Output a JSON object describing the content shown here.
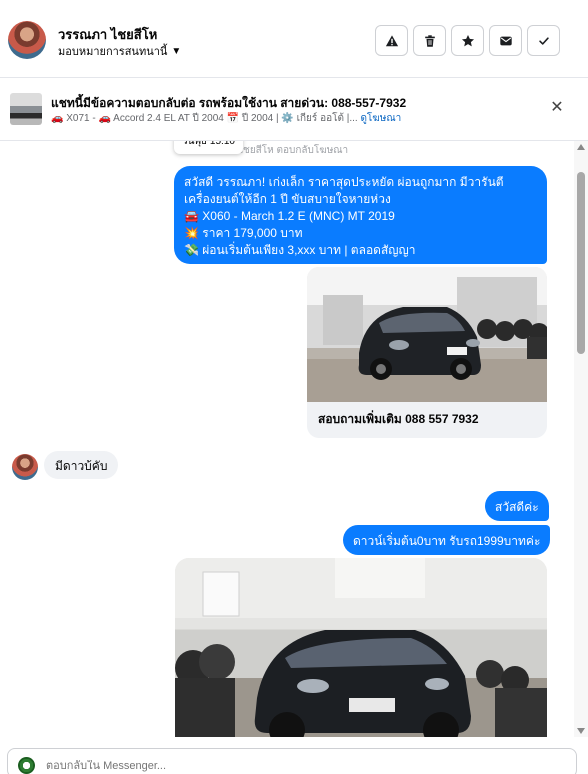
{
  "header": {
    "contact_name": "วรรณภา ไชยสีโห",
    "assign_label": "มอบหมายการสนทนานี้",
    "buttons": [
      "warning-icon",
      "trash-icon",
      "star-icon",
      "envelope-icon",
      "check-icon"
    ]
  },
  "ad": {
    "title": "แชทนี้มีข้อความตอบกลับต่อ รถพร้อมใช้งาน สายด่วน: 088-557-7932",
    "subtitle": "🚗 X071 - 🚗 Accord 2.4 EL AT ปี 2004 📅 ปี 2004 | ⚙️ เกียร์ ออโต้ |...",
    "link": "ดูโฆษณา"
  },
  "thread": {
    "reply_meta": "ไชยสีโห ตอบกลับโฆษณา",
    "tooltip": "วันพุธ 15:10",
    "message1": [
      "สวัสดี วรรณภา! เก่งเล็ก ราคาสุดประหยัด ผ่อนถูกมาก มีวารันตี",
      "เครื่องยนต์ให้อีก 1 ปี ขับสบายใจหายห่วง",
      "🚘 X060 - March 1.2 E (MNC) MT 2019",
      "💥 ราคา 179,000 บาท",
      "💸 ผ่อนเริ่มต้นเพียง 3,xxx บาท | ตลอดสัญญา"
    ],
    "card_caption": "สอบถามเพิ่มเติม 088 557 7932",
    "customer_reply": "มีดาวบ้คับ",
    "reply_hello": "สวัสดีค่ะ",
    "reply_down": "ดาวน์เริ่มต้น0บาท รับรถ1999บาทค่ะ"
  },
  "composer": {
    "placeholder": "ตอบกลับใน Messenger..."
  },
  "colors": {
    "accent": "#0a7cff",
    "incoming": "#f0f2f5",
    "link": "#0a66c2"
  }
}
